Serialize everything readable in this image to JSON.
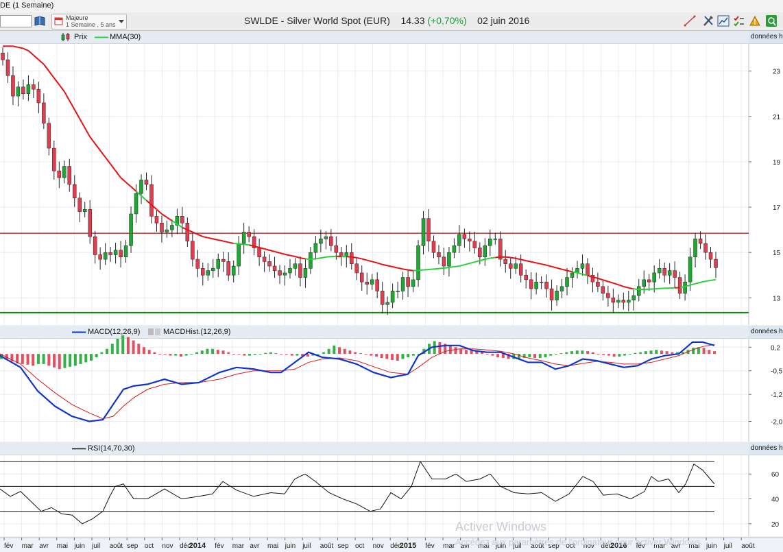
{
  "window": {
    "title_fragment": "DE (1 Semaine)"
  },
  "toolbar": {
    "period_line1": "Majeure",
    "period_line2": "1 Semaine , 5 ans",
    "instrument": "SWLDE - Silver World Spot (EUR)",
    "price": "14.33",
    "change": "(+0,70%)",
    "date": "02 juin 2016",
    "icons": [
      "trendline-icon",
      "tools-icon",
      "chart-settings-icon",
      "checklist-icon",
      "alerts-icon",
      "scanner-icon"
    ]
  },
  "side_label": "données h",
  "watermark": {
    "line1": "Activer Windows",
    "line2": "Accédez aux paramètres de l'ordinateur pour activer Windows."
  },
  "colors": {
    "bull": "#1ea832",
    "bear": "#e23c4f",
    "mma": "#2bd13a",
    "mma_below": "#e81010",
    "macd": "#1133cc",
    "signal": "#d81a1a",
    "resistance": "#a01010",
    "support": "#0a8a0a"
  },
  "chart_data": [
    {
      "type": "candlestick",
      "legend": [
        "Prix",
        "MMA(30)"
      ],
      "ylim": [
        11.8,
        24.2
      ],
      "y_ticks": [
        13,
        15,
        17,
        19,
        21,
        23
      ],
      "x_tick_labels": [
        "fév",
        "mar",
        "avr",
        "mai",
        "juin",
        "juil",
        "août",
        "sep",
        "oct",
        "nov",
        "déc",
        "2014",
        "fév",
        "mar",
        "avr",
        "mai",
        "juin",
        "juil",
        "août",
        "sep",
        "oct",
        "nov",
        "déc",
        "2015",
        "fév",
        "mar",
        "avr",
        "mai",
        "juin",
        "juil",
        "août",
        "sep",
        "oct",
        "nov",
        "déc",
        "2016",
        "fév",
        "mar",
        "avr",
        "mai",
        "juin",
        "juil",
        "août"
      ],
      "horizontal_lines": [
        15.85,
        12.35
      ],
      "closes": [
        23.5,
        22.8,
        21.9,
        22.3,
        22.0,
        22.4,
        22.2,
        21.6,
        20.7,
        19.6,
        18.6,
        18.3,
        18.8,
        18.0,
        17.4,
        16.8,
        16.9,
        15.7,
        14.9,
        14.7,
        15.0,
        14.9,
        15.1,
        14.8,
        15.3,
        16.7,
        17.6,
        18.2,
        18.0,
        16.6,
        16.3,
        15.9,
        16.0,
        16.2,
        16.6,
        16.3,
        15.5,
        14.7,
        14.3,
        14.0,
        14.2,
        14.3,
        14.7,
        14.6,
        14.0,
        14.4,
        15.4,
        15.9,
        15.7,
        15.2,
        14.8,
        14.6,
        14.4,
        14.2,
        14.0,
        14.1,
        14.3,
        14.5,
        13.9,
        14.3,
        15.0,
        15.4,
        15.6,
        15.7,
        15.3,
        15.0,
        14.8,
        15.0,
        14.5,
        14.1,
        13.7,
        13.6,
        13.8,
        13.3,
        12.7,
        12.8,
        13.3,
        13.3,
        13.9,
        13.5,
        13.8,
        15.3,
        16.5,
        15.5,
        15.0,
        14.8,
        14.4,
        15.0,
        15.3,
        15.8,
        15.6,
        15.5,
        15.2,
        14.8,
        15.3,
        15.6,
        15.6,
        14.7,
        14.5,
        14.3,
        14.5,
        14.0,
        13.8,
        13.4,
        13.7,
        13.7,
        13.4,
        12.9,
        13.3,
        13.5,
        13.9,
        14.1,
        14.3,
        14.5,
        14.0,
        13.7,
        13.5,
        13.2,
        13.0,
        12.8,
        12.9,
        12.8,
        12.9,
        13.1,
        13.5,
        13.8,
        13.7,
        14.1,
        14.3,
        14.0,
        14.2,
        13.9,
        13.2,
        13.7,
        14.8,
        15.6,
        15.4,
        15.0,
        14.7,
        14.33
      ],
      "mma": [
        24.1,
        24.1,
        24.1,
        24.05,
        24.0,
        23.9,
        23.7,
        23.5,
        23.3,
        23.0,
        22.7,
        22.4,
        22.1,
        21.7,
        21.3,
        20.9,
        20.5,
        20.1,
        19.8,
        19.5,
        19.2,
        18.9,
        18.6,
        18.3,
        18.1,
        17.9,
        17.7,
        17.5,
        17.3,
        17.1,
        16.9,
        16.7,
        16.55,
        16.4,
        16.25,
        16.1,
        16.0,
        15.9,
        15.8,
        15.7,
        15.65,
        15.6,
        15.55,
        15.5,
        15.45,
        15.4,
        15.38,
        15.36,
        15.33,
        15.28,
        15.22,
        15.16,
        15.1,
        15.04,
        14.98,
        14.92,
        14.87,
        14.82,
        14.76,
        14.72,
        14.7,
        14.72,
        14.76,
        14.8,
        14.82,
        14.83,
        14.83,
        14.82,
        14.8,
        14.77,
        14.72,
        14.66,
        14.6,
        14.54,
        14.47,
        14.42,
        14.37,
        14.32,
        14.27,
        14.23,
        14.2,
        14.21,
        14.23,
        14.25,
        14.27,
        14.29,
        14.31,
        14.34,
        14.37,
        14.4,
        14.46,
        14.52,
        14.58,
        14.64,
        14.7,
        14.75,
        14.78,
        14.8,
        14.8,
        14.78,
        14.74,
        14.69,
        14.64,
        14.59,
        14.54,
        14.49,
        14.44,
        14.38,
        14.32,
        14.26,
        14.2,
        14.15,
        14.1,
        14.04,
        13.98,
        13.92,
        13.86,
        13.79,
        13.72,
        13.65,
        13.58,
        13.5,
        13.44,
        13.39,
        13.37,
        13.37,
        13.38,
        13.39,
        13.41,
        13.42,
        13.43,
        13.44,
        13.45,
        13.49,
        13.56,
        13.62,
        13.68,
        13.73,
        13.77,
        13.8
      ]
    },
    {
      "type": "line",
      "legend": [
        "MACD(12,26,9)",
        "MACDHist.(12,26,9)"
      ],
      "ylim": [
        -2.6,
        0.45
      ],
      "y_tick_labels": [
        "0,2",
        "-0,5",
        "-1,2",
        "-2,0"
      ],
      "y_tick_values": [
        0.2,
        -0.5,
        -1.2,
        -2.0
      ],
      "macd_points": [
        [
          0,
          -0.05
        ],
        [
          30,
          -0.4
        ],
        [
          55,
          -1.1
        ],
        [
          80,
          -1.55
        ],
        [
          105,
          -1.85
        ],
        [
          130,
          -2.0
        ],
        [
          150,
          -1.95
        ],
        [
          165,
          -1.5
        ],
        [
          180,
          -1.05
        ],
        [
          195,
          -0.95
        ],
        [
          215,
          -0.9
        ],
        [
          240,
          -0.75
        ],
        [
          265,
          -0.9
        ],
        [
          290,
          -0.85
        ],
        [
          320,
          -0.55
        ],
        [
          345,
          -0.4
        ],
        [
          370,
          -0.45
        ],
        [
          395,
          -0.55
        ],
        [
          410,
          -0.55
        ],
        [
          430,
          -0.25
        ],
        [
          450,
          0.05
        ],
        [
          470,
          -0.1
        ],
        [
          495,
          -0.15
        ],
        [
          520,
          -0.3
        ],
        [
          545,
          -0.55
        ],
        [
          570,
          -0.7
        ],
        [
          595,
          -0.6
        ],
        [
          610,
          -0.05
        ],
        [
          630,
          0.2
        ],
        [
          650,
          0.25
        ],
        [
          670,
          0.25
        ],
        [
          690,
          0.1
        ],
        [
          710,
          0.05
        ],
        [
          730,
          0.05
        ],
        [
          750,
          -0.1
        ],
        [
          770,
          -0.25
        ],
        [
          790,
          -0.25
        ],
        [
          810,
          -0.45
        ],
        [
          830,
          -0.35
        ],
        [
          850,
          -0.15
        ],
        [
          870,
          -0.2
        ],
        [
          890,
          -0.3
        ],
        [
          910,
          -0.4
        ],
        [
          930,
          -0.35
        ],
        [
          950,
          -0.15
        ],
        [
          970,
          -0.05
        ],
        [
          990,
          0.0
        ],
        [
          1010,
          0.35
        ],
        [
          1025,
          0.35
        ],
        [
          1042,
          0.25
        ]
      ],
      "signal_points": [
        [
          0,
          0.0
        ],
        [
          30,
          -0.3
        ],
        [
          55,
          -0.75
        ],
        [
          80,
          -1.15
        ],
        [
          105,
          -1.5
        ],
        [
          130,
          -1.75
        ],
        [
          150,
          -1.92
        ],
        [
          165,
          -1.85
        ],
        [
          180,
          -1.55
        ],
        [
          195,
          -1.3
        ],
        [
          215,
          -1.05
        ],
        [
          240,
          -0.9
        ],
        [
          265,
          -0.85
        ],
        [
          290,
          -0.85
        ],
        [
          320,
          -0.75
        ],
        [
          345,
          -0.6
        ],
        [
          370,
          -0.5
        ],
        [
          395,
          -0.5
        ],
        [
          410,
          -0.5
        ],
        [
          430,
          -0.45
        ],
        [
          450,
          -0.25
        ],
        [
          470,
          -0.15
        ],
        [
          495,
          -0.12
        ],
        [
          520,
          -0.2
        ],
        [
          545,
          -0.38
        ],
        [
          570,
          -0.55
        ],
        [
          595,
          -0.6
        ],
        [
          610,
          -0.4
        ],
        [
          630,
          -0.1
        ],
        [
          650,
          0.08
        ],
        [
          670,
          0.15
        ],
        [
          690,
          0.15
        ],
        [
          710,
          0.12
        ],
        [
          730,
          0.08
        ],
        [
          750,
          0.0
        ],
        [
          770,
          -0.12
        ],
        [
          790,
          -0.2
        ],
        [
          810,
          -0.3
        ],
        [
          830,
          -0.35
        ],
        [
          850,
          -0.28
        ],
        [
          870,
          -0.22
        ],
        [
          890,
          -0.25
        ],
        [
          910,
          -0.3
        ],
        [
          930,
          -0.3
        ],
        [
          950,
          -0.25
        ],
        [
          970,
          -0.15
        ],
        [
          990,
          -0.05
        ],
        [
          1010,
          0.12
        ],
        [
          1025,
          0.22
        ],
        [
          1042,
          0.28
        ]
      ],
      "hist": [
        -0.15,
        -0.18,
        -0.22,
        -0.28,
        -0.3,
        -0.32,
        -0.35,
        -0.3,
        -0.3,
        -0.35,
        -0.4,
        -0.45,
        -0.42,
        -0.38,
        -0.35,
        -0.3,
        -0.25,
        -0.2,
        -0.1,
        0.05,
        0.15,
        0.3,
        0.45,
        0.55,
        0.5,
        0.4,
        0.3,
        0.2,
        0.12,
        0.05,
        0.0,
        -0.02,
        -0.05,
        -0.05,
        -0.08,
        -0.05,
        0.0,
        0.05,
        0.1,
        0.15,
        0.15,
        0.12,
        0.1,
        0.05,
        0.0,
        -0.02,
        -0.05,
        -0.05,
        -0.03,
        0.0,
        0.03,
        0.05,
        0.02,
        0.0,
        -0.02,
        -0.05,
        -0.05,
        -0.06,
        -0.08,
        -0.05,
        0.0,
        0.05,
        0.15,
        0.25,
        0.2,
        0.15,
        0.1,
        0.05,
        0.02,
        -0.02,
        -0.05,
        -0.08,
        -0.12,
        -0.15,
        -0.18,
        -0.2,
        -0.15,
        -0.1,
        -0.05,
        0.0,
        0.15,
        0.3,
        0.38,
        0.35,
        0.3,
        0.25,
        0.2,
        0.15,
        0.12,
        0.1,
        0.08,
        0.05,
        0.0,
        -0.05,
        -0.1,
        -0.12,
        -0.15,
        -0.15,
        -0.15,
        -0.12,
        -0.1,
        -0.12,
        -0.12,
        -0.1,
        -0.05,
        0.0,
        0.02,
        0.05,
        0.08,
        0.1,
        0.1,
        0.08,
        0.05,
        0.0,
        -0.03,
        -0.05,
        -0.08,
        -0.08,
        -0.05,
        0.0,
        0.03,
        0.05,
        0.08,
        0.1,
        0.12,
        0.1,
        0.08,
        0.05,
        0.05,
        0.06,
        0.12,
        0.18,
        0.2,
        0.18,
        0.12,
        0.08
      ]
    },
    {
      "type": "line",
      "legend": [
        "RSI(14,70,30)"
      ],
      "ylim": [
        10,
        75
      ],
      "y_ticks": [
        20,
        40,
        60
      ],
      "levels": [
        70,
        50,
        30
      ],
      "rsi_points": [
        [
          0,
          48
        ],
        [
          15,
          42
        ],
        [
          30,
          46
        ],
        [
          45,
          38
        ],
        [
          60,
          30
        ],
        [
          75,
          33
        ],
        [
          90,
          28
        ],
        [
          105,
          27
        ],
        [
          120,
          20
        ],
        [
          135,
          24
        ],
        [
          150,
          30
        ],
        [
          160,
          42
        ],
        [
          168,
          50
        ],
        [
          180,
          52
        ],
        [
          195,
          40
        ],
        [
          215,
          40
        ],
        [
          240,
          48
        ],
        [
          265,
          40
        ],
        [
          290,
          42
        ],
        [
          310,
          44
        ],
        [
          325,
          54
        ],
        [
          345,
          47
        ],
        [
          370,
          42
        ],
        [
          395,
          45
        ],
        [
          415,
          44
        ],
        [
          430,
          56
        ],
        [
          445,
          60
        ],
        [
          460,
          54
        ],
        [
          480,
          45
        ],
        [
          500,
          40
        ],
        [
          520,
          36
        ],
        [
          540,
          30
        ],
        [
          555,
          32
        ],
        [
          570,
          45
        ],
        [
          585,
          40
        ],
        [
          600,
          50
        ],
        [
          613,
          70
        ],
        [
          630,
          56
        ],
        [
          650,
          56
        ],
        [
          665,
          60
        ],
        [
          680,
          54
        ],
        [
          700,
          56
        ],
        [
          715,
          60
        ],
        [
          730,
          50
        ],
        [
          750,
          45
        ],
        [
          770,
          44
        ],
        [
          790,
          45
        ],
        [
          810,
          38
        ],
        [
          830,
          44
        ],
        [
          850,
          58
        ],
        [
          865,
          54
        ],
        [
          880,
          43
        ],
        [
          900,
          44
        ],
        [
          920,
          40
        ],
        [
          940,
          46
        ],
        [
          950,
          58
        ],
        [
          960,
          54
        ],
        [
          975,
          56
        ],
        [
          990,
          45
        ],
        [
          1000,
          52
        ],
        [
          1012,
          68
        ],
        [
          1025,
          63
        ],
        [
          1042,
          52
        ]
      ]
    }
  ]
}
